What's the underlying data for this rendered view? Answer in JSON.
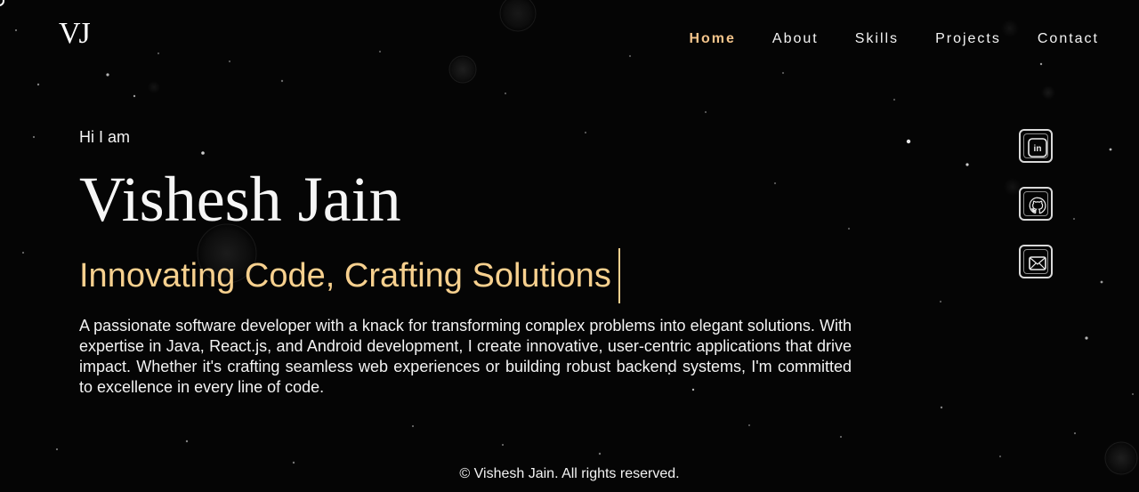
{
  "brand": {
    "logo_text": "VJ"
  },
  "nav": {
    "items": [
      {
        "label": "Home",
        "active": true
      },
      {
        "label": "About",
        "active": false
      },
      {
        "label": "Skills",
        "active": false
      },
      {
        "label": "Projects",
        "active": false
      },
      {
        "label": "Contact",
        "active": false
      }
    ]
  },
  "hero": {
    "greeting": "Hi I am",
    "name": "Vishesh Jain",
    "tagline": "Innovating Code, Crafting Solutions",
    "description": "A passionate software developer with a knack for transforming complex problems into elegant solutions. With expertise in Java, React.js, and Android development, I create innovative, user-centric applications that drive impact. Whether it's crafting seamless web experiences or building robust backend systems, I'm committed to excellence in every line of code."
  },
  "social": [
    {
      "icon": "linkedin-icon"
    },
    {
      "icon": "github-icon"
    },
    {
      "icon": "mail-icon"
    }
  ],
  "footer": {
    "copyright": "© Vishesh Jain. All rights reserved."
  },
  "colors": {
    "background": "#050505",
    "accent": "#f3c48b",
    "tagline": "#f7d08e",
    "text": "#f3f3f3"
  }
}
